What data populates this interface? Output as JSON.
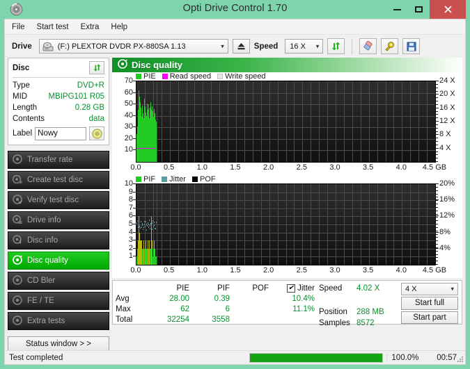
{
  "window": {
    "title": "Opti Drive Control 1.70",
    "icon": "disc-icon",
    "minimize": "minimize-icon",
    "maximize": "maximize-icon",
    "close": "close-icon"
  },
  "menubar": {
    "items": [
      "File",
      "Start test",
      "Extra",
      "Help"
    ]
  },
  "toolbar": {
    "drive_label": "Drive",
    "drive_value": "(F:)  PLEXTOR DVDR  PX-880SA 1.13",
    "eject_icon": "eject-icon",
    "speed_label": "Speed",
    "speed_value": "16 X",
    "refresh_icon": "refresh-icon",
    "erase_icon": "eraser-icon",
    "settings_icon": "gear-key-icon",
    "save_icon": "save-floppy-icon"
  },
  "disc": {
    "header": "Disc",
    "refresh_icon": "refresh-icon",
    "rows": [
      {
        "key": "Type",
        "value": "DVD+R"
      },
      {
        "key": "MID",
        "value": "MBIPG101 R05"
      },
      {
        "key": "Length",
        "value": "0.28 GB"
      },
      {
        "key": "Contents",
        "value": "data"
      }
    ],
    "label_key": "Label",
    "label_value": "Nowy",
    "label_placeholder": "Label",
    "disc_button_icon": "cd-disc-icon"
  },
  "sidebar": {
    "items": [
      {
        "label": "Transfer rate",
        "icon": "disc-icon",
        "active": false
      },
      {
        "label": "Create test disc",
        "icon": "disc-write-icon",
        "active": false
      },
      {
        "label": "Verify test disc",
        "icon": "disc-check-icon",
        "active": false
      },
      {
        "label": "Drive info",
        "icon": "drive-icon",
        "active": false
      },
      {
        "label": "Disc info",
        "icon": "disc-info-icon",
        "active": false
      },
      {
        "label": "Disc quality",
        "icon": "disc-quality-icon",
        "active": true
      },
      {
        "label": "CD Bler",
        "icon": "disc-icon",
        "active": false
      },
      {
        "label": "FE / TE",
        "icon": "disc-icon",
        "active": false
      },
      {
        "label": "Extra tests",
        "icon": "disc-icon",
        "active": false
      }
    ],
    "status_window_button": "Status window > >"
  },
  "panel": {
    "title": "Disc quality",
    "icon": "disc-quality-icon"
  },
  "stats": {
    "col_headers": [
      "PIE",
      "PIF",
      "POF",
      "Jitter"
    ],
    "jitter_checked": true,
    "jitter_check_glyph": "✔",
    "rows": [
      {
        "label": "Avg",
        "pie": "28.00",
        "pif": "0.39",
        "pof": "",
        "jitter": "10.4%"
      },
      {
        "label": "Max",
        "pie": "62",
        "pif": "6",
        "pof": "",
        "jitter": "11.1%"
      },
      {
        "label": "Total",
        "pie": "32254",
        "pif": "3558",
        "pof": "",
        "jitter": ""
      }
    ],
    "readout": [
      {
        "key": "Speed",
        "value": "4.02 X"
      },
      {
        "key": "Position",
        "value": "288 MB"
      },
      {
        "key": "Samples",
        "value": "8572"
      }
    ],
    "speed_select": "4 X",
    "start_full": "Start full",
    "start_part": "Start part"
  },
  "statusbar": {
    "message": "Test completed",
    "percent_label": "100.0%",
    "percent_value": 100,
    "elapsed": "00:57",
    "grip_icon": "resize-grip-icon"
  },
  "colors": {
    "titlebar": "#7ed4ad",
    "close": "#c9504f",
    "accent_green": "#00a800",
    "value_green": "#0a8f2e",
    "pie": "#22cc22",
    "pif": "#22cc22",
    "pif_high": "#b8b800",
    "pof": "#000000",
    "jitter": "#5f9ea0",
    "read_speed": "#ff00ff",
    "write_speed": "#e8e8e8",
    "cursor": "#ff0000",
    "plot_bg_top": "#2e2e2e",
    "plot_bg_bottom": "#101010",
    "grid": "#4c4c4c"
  },
  "chart_data": [
    {
      "type": "bar",
      "id": "pie-chart",
      "title": "PIE",
      "xlabel": "GB",
      "ylabel": "PIE",
      "legend": [
        {
          "label": "PIE",
          "color": "#22cc22"
        },
        {
          "label": "Read speed",
          "color": "#ff00ff"
        },
        {
          "label": "Write speed",
          "color": "#e8e8e8"
        }
      ],
      "legend_position": "top-left",
      "grid": true,
      "xlim": [
        0,
        4.5
      ],
      "xticks": [
        "0.0",
        "0.5",
        "1.0",
        "1.5",
        "2.0",
        "2.5",
        "3.0",
        "3.5",
        "4.0",
        "4.5 GB"
      ],
      "ylim": [
        0,
        70
      ],
      "yticks": [
        10,
        20,
        30,
        40,
        50,
        60,
        70
      ],
      "y2lim": [
        0,
        24
      ],
      "y2ticks": [
        "4 X",
        "8 X",
        "12 X",
        "16 X",
        "20 X",
        "24 X"
      ],
      "cursor_x": 0.3,
      "x": [
        0.005,
        0.013,
        0.02,
        0.028,
        0.036,
        0.043,
        0.051,
        0.059,
        0.066,
        0.074,
        0.082,
        0.089,
        0.097,
        0.105,
        0.112,
        0.12,
        0.128,
        0.135,
        0.143,
        0.151,
        0.158,
        0.166,
        0.174,
        0.181,
        0.189,
        0.197,
        0.204,
        0.212,
        0.22,
        0.227,
        0.235,
        0.243,
        0.25,
        0.258,
        0.266,
        0.273,
        0.281,
        0.289
      ],
      "values": [
        24,
        31,
        45,
        49,
        62,
        57,
        52,
        47,
        44,
        40,
        46,
        49,
        42,
        38,
        52,
        55,
        48,
        43,
        36,
        40,
        51,
        46,
        50,
        44,
        38,
        35,
        47,
        52,
        45,
        41,
        48,
        44,
        39,
        43,
        46,
        42,
        37,
        35
      ],
      "read_speed_series": {
        "constant": 4.02,
        "plot_y_level": 12
      }
    },
    {
      "type": "bar",
      "id": "pif-chart",
      "title": "PIF",
      "xlabel": "GB",
      "ylabel": "PIF",
      "legend": [
        {
          "label": "PIF",
          "color": "#22cc22"
        },
        {
          "label": "Jitter",
          "color": "#5f9ea0"
        },
        {
          "label": "POF",
          "color": "#000000"
        }
      ],
      "legend_position": "top-left",
      "grid": true,
      "xlim": [
        0,
        4.5
      ],
      "xticks": [
        "0.0",
        "0.5",
        "1.0",
        "1.5",
        "2.0",
        "2.5",
        "3.0",
        "3.5",
        "4.0",
        "4.5 GB"
      ],
      "ylim": [
        0,
        10
      ],
      "yticks": [
        1,
        2,
        3,
        4,
        5,
        6,
        7,
        8,
        9,
        10
      ],
      "y2lim": [
        0,
        20
      ],
      "y2ticks": [
        "4%",
        "8%",
        "12%",
        "16%",
        "20%"
      ],
      "cursor_x": 0.3,
      "x": [
        0.005,
        0.013,
        0.02,
        0.028,
        0.036,
        0.043,
        0.051,
        0.059,
        0.066,
        0.074,
        0.082,
        0.089,
        0.097,
        0.105,
        0.112,
        0.12,
        0.128,
        0.135,
        0.143,
        0.151,
        0.158,
        0.166,
        0.174,
        0.181,
        0.189,
        0.197,
        0.204,
        0.212,
        0.22,
        0.227,
        0.235,
        0.243,
        0.25,
        0.258,
        0.266,
        0.273,
        0.281,
        0.289
      ],
      "values": [
        1,
        2,
        3,
        4,
        6,
        4,
        3,
        2,
        3,
        3,
        2,
        1,
        2,
        3,
        2,
        1,
        2,
        3,
        2,
        1,
        2,
        3,
        2,
        1,
        3,
        2,
        1,
        2,
        6,
        3,
        2,
        1,
        2,
        3,
        1,
        2,
        1,
        1
      ],
      "jitter_series": {
        "avg": 10.4,
        "max": 11.1,
        "plot_y_level": 5
      }
    }
  ]
}
